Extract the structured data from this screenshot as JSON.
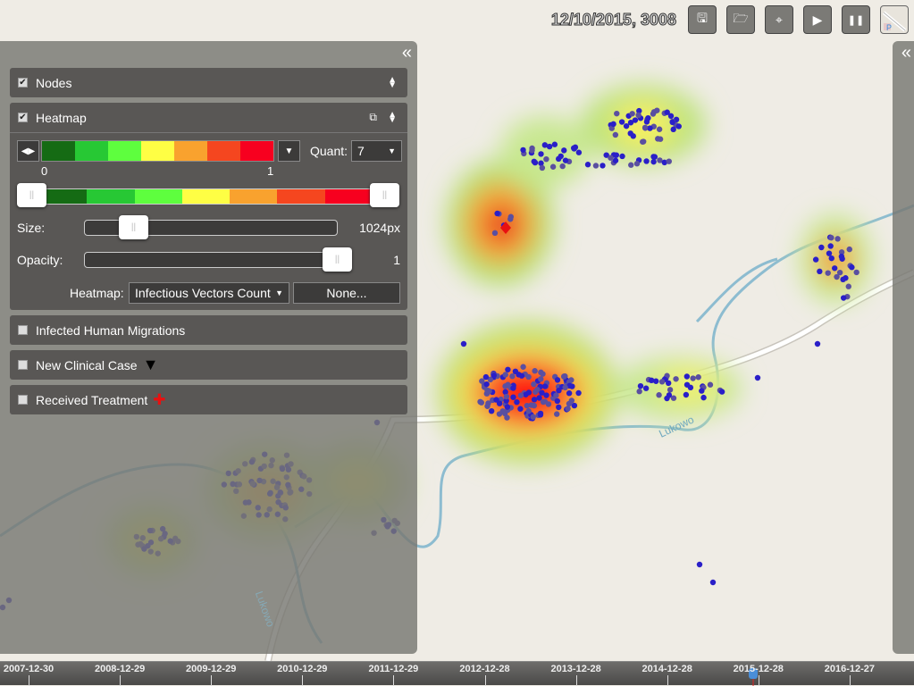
{
  "header": {
    "datetime": "12/10/2015, 3008"
  },
  "toolbar": [
    {
      "name": "save-button",
      "icon": "floppy-icon",
      "glyph": "🖫"
    },
    {
      "name": "open-button",
      "icon": "folder-open-icon",
      "glyph": "🗁"
    },
    {
      "name": "center-button",
      "icon": "crosshair-icon",
      "glyph": "⌖"
    },
    {
      "name": "play-button",
      "icon": "play-icon",
      "glyph": "▶"
    },
    {
      "name": "pause-button",
      "icon": "pause-icon",
      "glyph": "❚❚"
    },
    {
      "name": "layer-toggle-button",
      "icon": "map-thumbnail-icon",
      "glyph": ""
    }
  ],
  "panel": {
    "collapse_glyph": "«",
    "nodes": {
      "label": "Nodes",
      "checked": true
    },
    "heatmap": {
      "label": "Heatmap",
      "checked": true,
      "colors": [
        "#156b14",
        "#27c834",
        "#5efe3e",
        "#fefe44",
        "#f9a22e",
        "#f5461f",
        "#f7001f"
      ],
      "range_min": "0",
      "range_max": "1",
      "quant_label": "Quant:",
      "quant_value": "7",
      "size_label": "Size:",
      "size_value": "1024px",
      "size_fraction": 0.2,
      "opacity_label": "Opacity:",
      "opacity_value": "1",
      "opacity_fraction": 1,
      "source_label": "Heatmap:",
      "source_value": "Infectious Vectors Count",
      "none_button": "None..."
    },
    "migrations": {
      "label": "Infected Human Migrations",
      "checked": false
    },
    "clinical": {
      "label": "New Clinical Case",
      "checked": false,
      "marker": "▼"
    },
    "treatment": {
      "label": "Received Treatment",
      "checked": false,
      "marker": "✚",
      "marker_color": "#e81010"
    }
  },
  "map": {
    "river_labels": [
      "Lukowo",
      "Lukowo"
    ]
  },
  "timeline": {
    "labels": [
      "2007-12-30",
      "2008-12-29",
      "2009-12-29",
      "2010-12-29",
      "2011-12-29",
      "2012-12-28",
      "2013-12-28",
      "2014-12-28",
      "2015-12-28",
      "2016-12-27"
    ],
    "current": "2015-12-10"
  }
}
